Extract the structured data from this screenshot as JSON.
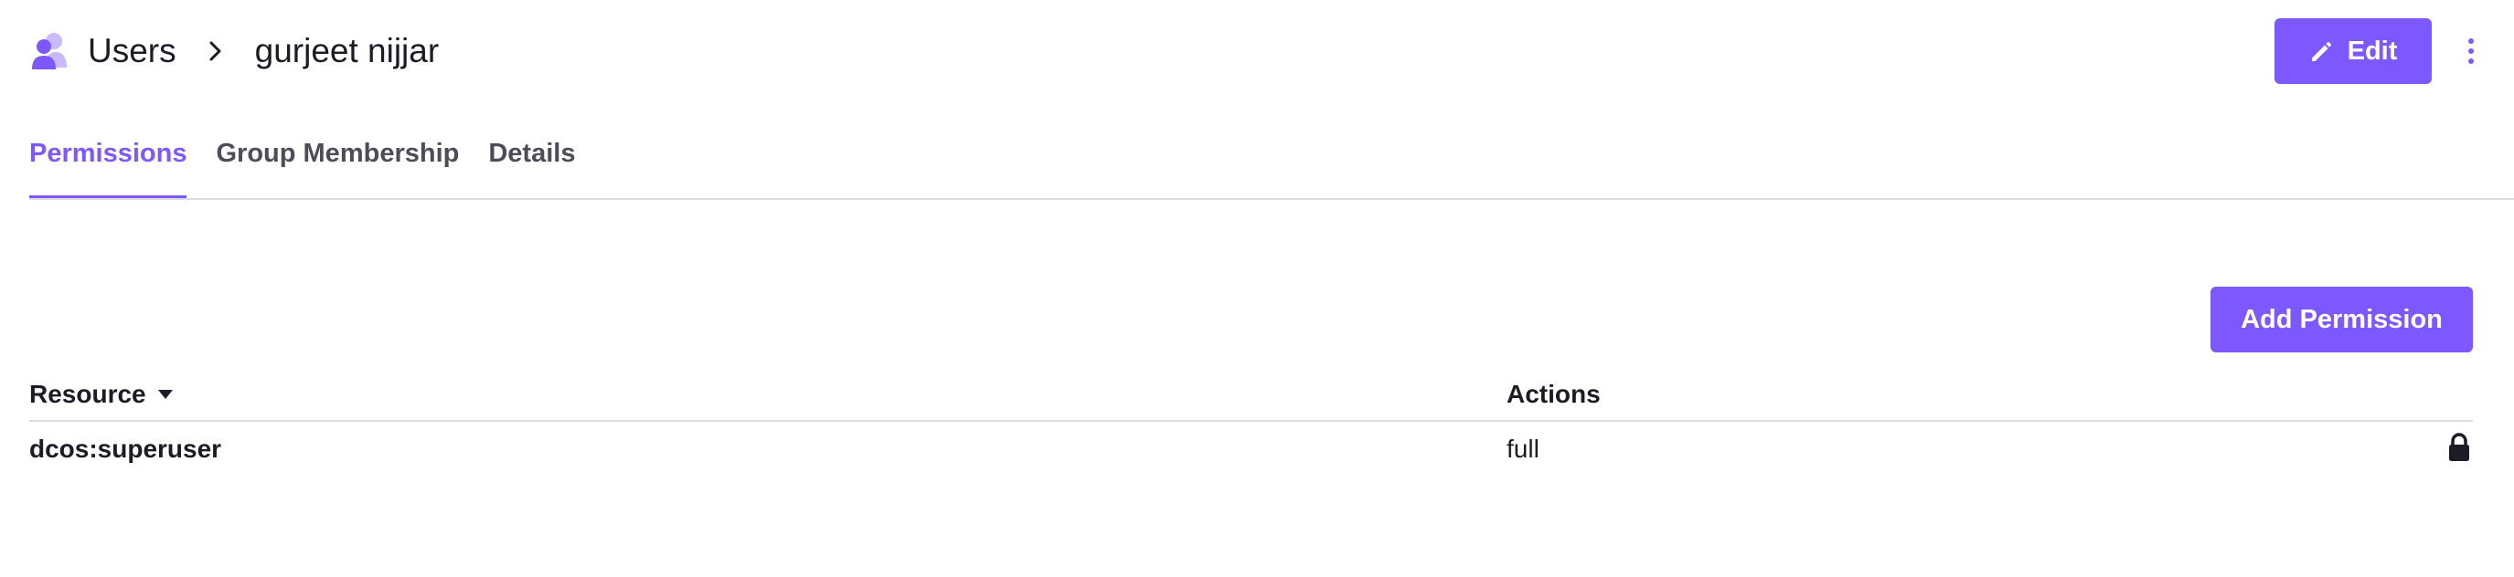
{
  "header": {
    "breadcrumb_root": "Users",
    "breadcrumb_current": "gurjeet nijjar",
    "edit_label": "Edit"
  },
  "tabs": [
    {
      "label": "Permissions",
      "active": true
    },
    {
      "label": "Group Membership",
      "active": false
    },
    {
      "label": "Details",
      "active": false
    }
  ],
  "toolbar": {
    "add_permission_label": "Add Permission"
  },
  "table": {
    "columns": [
      "Resource",
      "Actions"
    ],
    "sort_column": "Resource",
    "rows": [
      {
        "resource": "dcos:superuser",
        "actions": "full",
        "locked": true
      }
    ]
  },
  "icons": {
    "users": "users-icon",
    "chevron": "chevron-right-icon",
    "edit": "pencil-icon",
    "more": "kebab-menu-icon",
    "sort": "caret-down-icon",
    "lock": "lock-icon"
  },
  "colors": {
    "accent": "#7d58ff",
    "text": "#1b1c25",
    "muted": "#4b4d58",
    "border": "#dadde2"
  }
}
